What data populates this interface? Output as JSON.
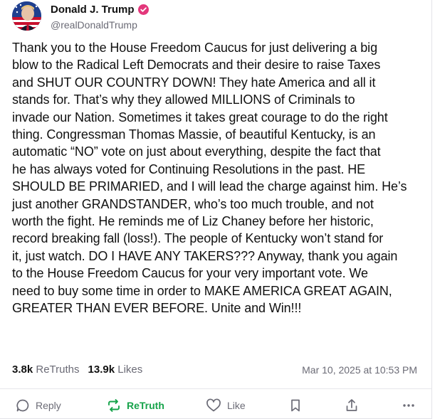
{
  "post": {
    "author": {
      "display_name": "Donald J. Trump",
      "handle": "@realDonaldTrump",
      "verified": true,
      "avatar_icon": "avatar-portrait"
    },
    "body_lines": [
      "Thank you to the House Freedom Caucus for just delivering a big",
      "blow to the Radical Left Democrats and their desire to raise Taxes",
      "and SHUT OUR COUNTRY DOWN! They hate America and all it",
      "stands for. That’s why they allowed MILLIONS of Criminals to",
      "invade our Nation. Sometimes it takes great courage to do the right",
      "thing. Congressman Thomas Massie, of beautiful Kentucky, is an",
      "automatic “NO” vote on just about everything, despite the fact that",
      "he has always voted for Continuing Resolutions in the past. HE",
      "SHOULD BE PRIMARIED, and I will lead the charge against him. He’s",
      "just another GRANDSTANDER, who’s too much trouble, and not",
      "worth the fight. He reminds me of Liz Chaney before her historic,",
      "record breaking fall (loss!). The people of Kentucky won’t stand for",
      "it, just watch. DO I HAVE ANY TAKERS??? Anyway, thank you again",
      "to the House Freedom Caucus for your very important vote. We",
      "need to buy some time in order to MAKE AMERICA GREAT AGAIN,",
      "GREATER THAN EVER BEFORE. Unite and Win!!!"
    ],
    "stats": {
      "retruths_count": "3.8k",
      "retruths_label": "ReTruths",
      "likes_count": "13.9k",
      "likes_label": "Likes"
    },
    "timestamp": "Mar 10, 2025 at 10:53 PM"
  },
  "actions": {
    "reply_label": "Reply",
    "retruth_label": "ReTruth",
    "like_label": "Like",
    "icons": [
      "reply-icon",
      "retruth-icon",
      "like-icon",
      "bookmark-icon",
      "share-icon",
      "more-icon"
    ]
  },
  "colors": {
    "verified_badge": "#e3377b",
    "retruth_active": "#16a34a",
    "muted_text": "#6b6b76"
  }
}
